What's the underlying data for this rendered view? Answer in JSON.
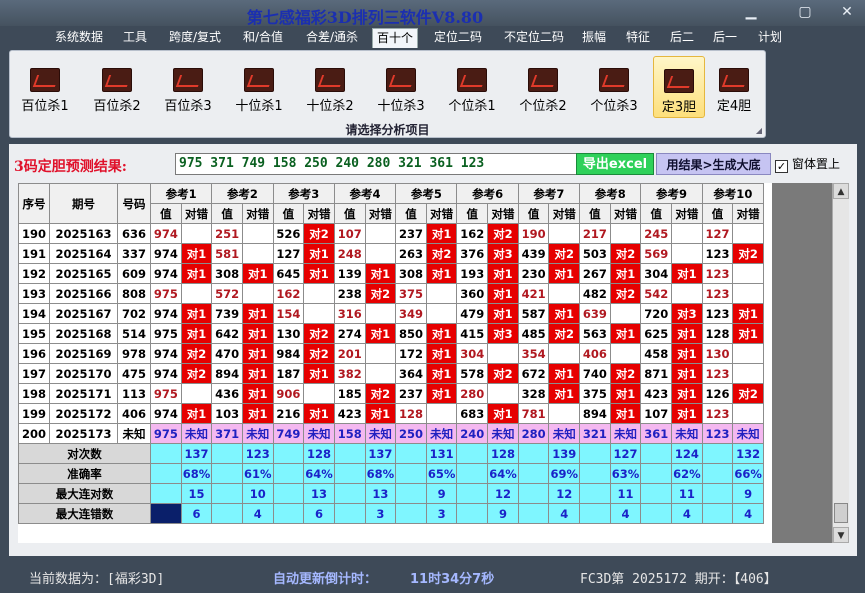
{
  "window": {
    "title": "第七感福彩3D排列三软件V8.80",
    "minimize": "▁",
    "restore": "▢",
    "close": "✕"
  },
  "menu": [
    "系统数据",
    "工具",
    "跨度/复式",
    "和/合值",
    "合差/通杀",
    "百十个",
    "定位二码",
    "不定位二码",
    "振幅",
    "特征",
    "后二",
    "后一",
    "计划"
  ],
  "menu_active": 5,
  "ribbon": {
    "buttons": [
      "百位杀1",
      "百位杀2",
      "百位杀3",
      "十位杀1",
      "十位杀2",
      "十位杀3",
      "个位杀1",
      "个位杀2",
      "个位杀3",
      "定3胆",
      "定4胆"
    ],
    "active": 9,
    "caption": "请选择分析项目",
    "icon": "chart-icon"
  },
  "prediction": {
    "label": "3码定胆预测结果:",
    "value": "975 371 749 158 250 240 280 321 361 123"
  },
  "buttons": {
    "export": "导出excel",
    "generate": "用结果>生成大底"
  },
  "topmost": {
    "label": "窗体置上",
    "checked": "✓"
  },
  "table": {
    "col_index": "序号",
    "col_period": "期号",
    "col_number": "号码",
    "groups": [
      "参考1",
      "参考2",
      "参考3",
      "参考4",
      "参考5",
      "参考6",
      "参考7",
      "参考8",
      "参考9",
      "参考10"
    ],
    "sub_value": "值",
    "sub_result": "对错",
    "rows": [
      {
        "i": "190",
        "p": "2025163",
        "n": "636",
        "c": [
          [
            "974",
            ""
          ],
          [
            "251",
            ""
          ],
          [
            "526",
            "对2"
          ],
          [
            "107",
            ""
          ],
          [
            "237",
            "对1"
          ],
          [
            "162",
            "对2"
          ],
          [
            "190",
            ""
          ],
          [
            "217",
            ""
          ],
          [
            "245",
            ""
          ],
          [
            "127",
            ""
          ]
        ]
      },
      {
        "i": "191",
        "p": "2025164",
        "n": "337",
        "c": [
          [
            "974",
            "对1"
          ],
          [
            "581",
            ""
          ],
          [
            "127",
            "对1"
          ],
          [
            "248",
            ""
          ],
          [
            "263",
            "对2"
          ],
          [
            "376",
            "对3"
          ],
          [
            "439",
            "对2"
          ],
          [
            "503",
            "对2"
          ],
          [
            "569",
            ""
          ],
          [
            "123",
            "对2"
          ]
        ]
      },
      {
        "i": "192",
        "p": "2025165",
        "n": "609",
        "c": [
          [
            "974",
            "对1"
          ],
          [
            "308",
            "对1"
          ],
          [
            "645",
            "对1"
          ],
          [
            "139",
            "对1"
          ],
          [
            "308",
            "对1"
          ],
          [
            "193",
            "对1"
          ],
          [
            "230",
            "对1"
          ],
          [
            "267",
            "对1"
          ],
          [
            "304",
            "对1"
          ],
          [
            "123",
            ""
          ]
        ]
      },
      {
        "i": "193",
        "p": "2025166",
        "n": "808",
        "c": [
          [
            "975",
            ""
          ],
          [
            "572",
            ""
          ],
          [
            "162",
            ""
          ],
          [
            "238",
            "对2"
          ],
          [
            "375",
            ""
          ],
          [
            "360",
            "对1"
          ],
          [
            "421",
            ""
          ],
          [
            "482",
            "对2"
          ],
          [
            "542",
            ""
          ],
          [
            "123",
            ""
          ]
        ]
      },
      {
        "i": "194",
        "p": "2025167",
        "n": "702",
        "c": [
          [
            "974",
            "对1"
          ],
          [
            "739",
            "对1"
          ],
          [
            "154",
            ""
          ],
          [
            "316",
            ""
          ],
          [
            "349",
            ""
          ],
          [
            "479",
            "对1"
          ],
          [
            "587",
            "对1"
          ],
          [
            "639",
            ""
          ],
          [
            "720",
            "对3"
          ],
          [
            "123",
            "对1"
          ]
        ]
      },
      {
        "i": "195",
        "p": "2025168",
        "n": "514",
        "c": [
          [
            "975",
            "对1"
          ],
          [
            "642",
            "对1"
          ],
          [
            "130",
            "对2"
          ],
          [
            "274",
            "对1"
          ],
          [
            "850",
            "对1"
          ],
          [
            "415",
            "对3"
          ],
          [
            "485",
            "对2"
          ],
          [
            "563",
            "对1"
          ],
          [
            "625",
            "对1"
          ],
          [
            "128",
            "对1"
          ]
        ]
      },
      {
        "i": "196",
        "p": "2025169",
        "n": "978",
        "c": [
          [
            "974",
            "对2"
          ],
          [
            "470",
            "对1"
          ],
          [
            "984",
            "对2"
          ],
          [
            "201",
            ""
          ],
          [
            "172",
            "对1"
          ],
          [
            "304",
            ""
          ],
          [
            "354",
            ""
          ],
          [
            "406",
            ""
          ],
          [
            "458",
            "对1"
          ],
          [
            "130",
            ""
          ]
        ]
      },
      {
        "i": "197",
        "p": "2025170",
        "n": "475",
        "c": [
          [
            "974",
            "对2"
          ],
          [
            "894",
            "对1"
          ],
          [
            "187",
            "对1"
          ],
          [
            "382",
            ""
          ],
          [
            "364",
            "对1"
          ],
          [
            "578",
            "对2"
          ],
          [
            "672",
            "对1"
          ],
          [
            "740",
            "对2"
          ],
          [
            "871",
            "对1"
          ],
          [
            "123",
            ""
          ]
        ]
      },
      {
        "i": "198",
        "p": "2025171",
        "n": "113",
        "c": [
          [
            "975",
            ""
          ],
          [
            "436",
            "对1"
          ],
          [
            "906",
            ""
          ],
          [
            "185",
            "对2"
          ],
          [
            "237",
            "对1"
          ],
          [
            "280",
            ""
          ],
          [
            "328",
            "对1"
          ],
          [
            "375",
            "对1"
          ],
          [
            "423",
            "对1"
          ],
          [
            "126",
            "对2"
          ]
        ]
      },
      {
        "i": "199",
        "p": "2025172",
        "n": "406",
        "c": [
          [
            "974",
            "对1"
          ],
          [
            "103",
            "对1"
          ],
          [
            "216",
            "对1"
          ],
          [
            "423",
            "对1"
          ],
          [
            "128",
            ""
          ],
          [
            "683",
            "对1"
          ],
          [
            "781",
            ""
          ],
          [
            "894",
            "对1"
          ],
          [
            "107",
            "对1"
          ],
          [
            "123",
            ""
          ]
        ]
      }
    ],
    "pending": {
      "i": "200",
      "p": "2025173",
      "n": "未知",
      "values": [
        "975",
        "371",
        "749",
        "158",
        "250",
        "240",
        "280",
        "321",
        "361",
        "123"
      ],
      "unknown": "未知"
    },
    "stats": [
      {
        "label": "对次数",
        "values": [
          "137",
          "123",
          "128",
          "137",
          "131",
          "128",
          "139",
          "127",
          "124",
          "132"
        ]
      },
      {
        "label": "准确率",
        "values": [
          "68%",
          "61%",
          "64%",
          "68%",
          "65%",
          "64%",
          "69%",
          "63%",
          "62%",
          "66%"
        ]
      },
      {
        "label": "最大连对数",
        "values": [
          "15",
          "10",
          "13",
          "13",
          "9",
          "12",
          "12",
          "11",
          "11",
          "9"
        ]
      },
      {
        "label": "最大连错数",
        "values": [
          "6",
          "4",
          "6",
          "3",
          "3",
          "9",
          "4",
          "4",
          "4",
          "4"
        ]
      }
    ]
  },
  "status": {
    "current_data": "当前数据为：[福彩3D]",
    "countdown_label": "自动更新倒计时：",
    "countdown_value": "11时34分7秒",
    "draw_info": "FC3D第 2025172 期开：【406】"
  },
  "colors": {
    "result_cell": "#e60000",
    "pending_row": "#f4b8f0",
    "stats_cell": "#7ff6ff",
    "selected_cell": "#0a1f6a"
  }
}
